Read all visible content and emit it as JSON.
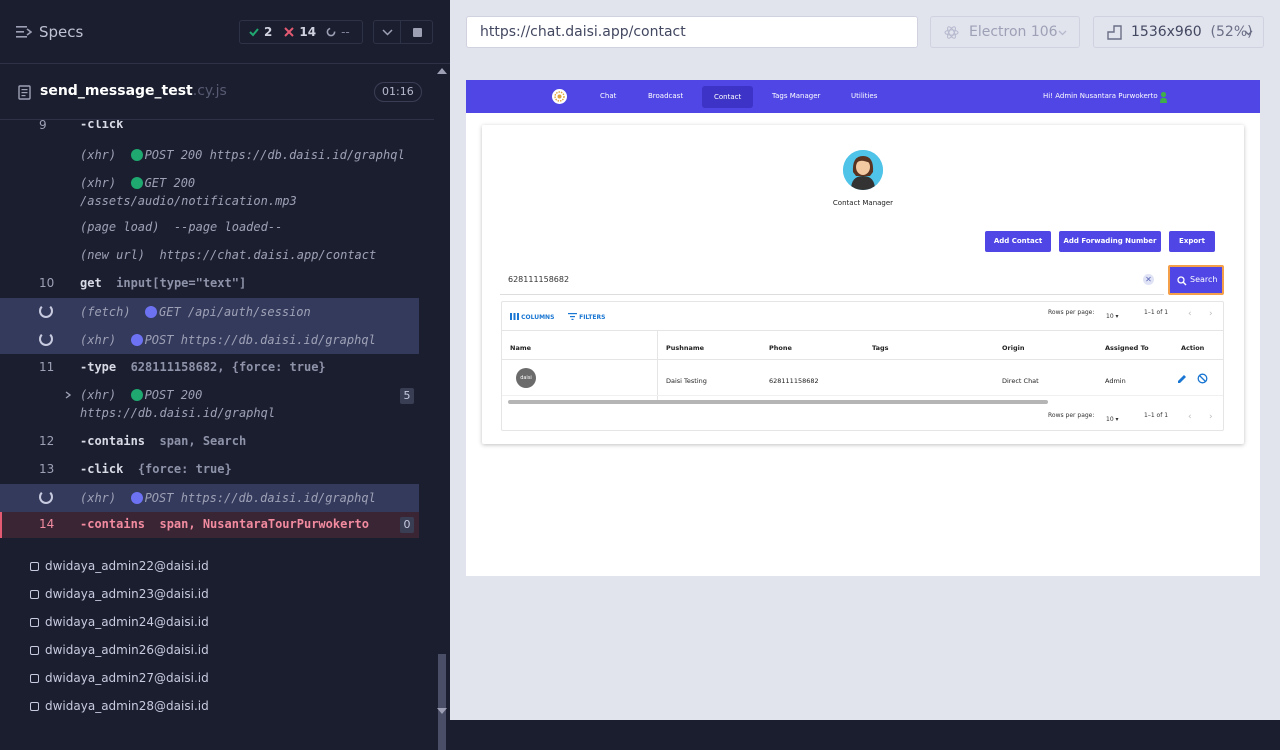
{
  "sidebar": {
    "title": "Specs",
    "stats": {
      "passed": "2",
      "failed": "14",
      "pending": "--"
    },
    "file": {
      "name": "send_message_test",
      "ext": ".cy.js",
      "time": "01:16"
    },
    "commands": [
      {
        "num": "9",
        "name": "-click",
        "msg": "",
        "type": "normal"
      },
      {
        "num": "",
        "name": "(xhr)",
        "dot": "#1fa971",
        "msg": "POST 200 https://db.daisi.id/graphql",
        "type": "log"
      },
      {
        "num": "",
        "name": "(xhr)",
        "dot": "#1fa971",
        "msg": "GET 200",
        "msg2": "/assets/audio/notification.mp3",
        "type": "log"
      },
      {
        "num": "",
        "name": "(page load)",
        "msg": "--page loaded--",
        "type": "log"
      },
      {
        "num": "",
        "name": "(new url)",
        "msg": "https://chat.daisi.app/contact",
        "type": "log"
      },
      {
        "num": "10",
        "name": "get",
        "msg": "input[type=\"text\"]",
        "type": "normal"
      },
      {
        "num": "",
        "name": "(fetch)",
        "dot": "#6d72f2",
        "msg": "GET /api/auth/session",
        "type": "pending"
      },
      {
        "num": "",
        "name": "(xhr)",
        "dot": "#6d72f2",
        "msg": "POST https://db.daisi.id/graphql",
        "type": "pending"
      },
      {
        "num": "11",
        "name": "-type",
        "msg": "628111158682, {force: true}",
        "type": "normal"
      },
      {
        "num": "",
        "name": "(xhr)",
        "dot": "#1fa971",
        "msg": "POST 200",
        "msg2": "https://db.daisi.id/graphql",
        "badge": "5",
        "type": "log"
      },
      {
        "num": "12",
        "name": "-contains",
        "msg": "span, Search",
        "type": "normal"
      },
      {
        "num": "13",
        "name": "-click",
        "msg": "{force: true}",
        "type": "normal"
      },
      {
        "num": "",
        "name": "(xhr)",
        "dot": "#6d72f2",
        "msg": "POST https://db.daisi.id/graphql",
        "type": "pending"
      },
      {
        "num": "14",
        "name": "-contains",
        "msg": "span, NusantaraTourPurwokerto",
        "badge": "0",
        "type": "failed"
      }
    ],
    "tests": [
      "dwidaya_admin22@daisi.id",
      "dwidaya_admin23@daisi.id",
      "dwidaya_admin24@daisi.id",
      "dwidaya_admin26@daisi.id",
      "dwidaya_admin27@daisi.id",
      "dwidaya_admin28@daisi.id"
    ]
  },
  "browser": {
    "url": "https://chat.daisi.app/contact",
    "engine": "Electron 106",
    "viewport": "1536x960",
    "scale": "(52%)"
  },
  "app": {
    "nav": [
      "Chat",
      "Broadcast",
      "Contact",
      "Tags Manager",
      "Utilities"
    ],
    "active_nav": "Contact",
    "greeting": "Hi! Admin Nusantara Purwokerto",
    "page_title": "Contact Manager",
    "buttons": {
      "add_contact": "Add Contact",
      "add_forwarding": "Add Forwading Number",
      "export": "Export"
    },
    "search": {
      "value": "628111158682",
      "button": "Search"
    },
    "grid": {
      "columns_btn": "COLUMNS",
      "filters_btn": "FILTERS",
      "rows_per_page_label": "Rows per page:",
      "rows_per_page": "10",
      "range": "1–1 of 1",
      "headers": [
        "Name",
        "Pushname",
        "Phone",
        "Tags",
        "Origin",
        "Assigned To",
        "Action"
      ],
      "rows": [
        {
          "avatar_text": "daisi",
          "pushname": "Daisi Testing",
          "phone": "628111158682",
          "tags": "",
          "origin": "Direct Chat",
          "assigned": "Admin"
        }
      ]
    }
  },
  "colors": {
    "accent": "#5046e5",
    "pass": "#1fa971",
    "fail": "#e25a72",
    "pending": "#6d72f2"
  }
}
